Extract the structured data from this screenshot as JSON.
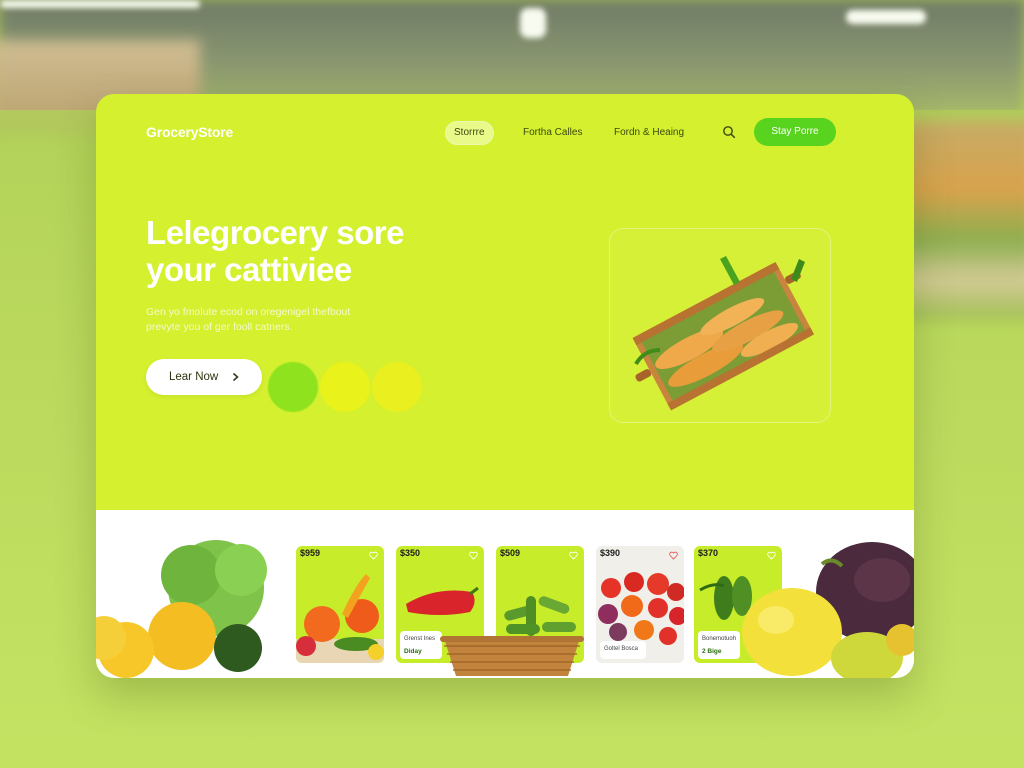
{
  "brand": {
    "logo_text": "GroceryStore"
  },
  "nav": {
    "items": [
      {
        "label": "Storrre",
        "active": true
      },
      {
        "label": "Fortha Calles",
        "active": false
      },
      {
        "label": "Fordn & Heaing",
        "active": false
      }
    ],
    "search_icon": "search-icon",
    "cta_label": "Stay Porre"
  },
  "hero": {
    "title_line1": "Lelegrocery sore",
    "title_line2": "your cattiviee",
    "subtitle_line1": "Gen yo fmolute ecod on oregenigel thefbout",
    "subtitle_line2": "prevyte you of ger fooll catners.",
    "button_label": "Lear Now",
    "dots": [
      "#8fe21e",
      "#e9f21a",
      "#eaf020"
    ]
  },
  "products": [
    {
      "price": "$959",
      "name": "",
      "sub": ""
    },
    {
      "price": "$350",
      "name": "Grenst Ines",
      "sub": "Diday"
    },
    {
      "price": "$509",
      "name": "",
      "sub": ""
    },
    {
      "price": "$390",
      "name": "Goltel Bosca",
      "sub": ""
    },
    {
      "price": "$370",
      "name": "Bonemotuoh",
      "sub": "2 Bige"
    }
  ],
  "colors": {
    "brand_lime": "#d4f02e",
    "button_green": "#58d41e",
    "card_green": "#c7ec2a"
  }
}
